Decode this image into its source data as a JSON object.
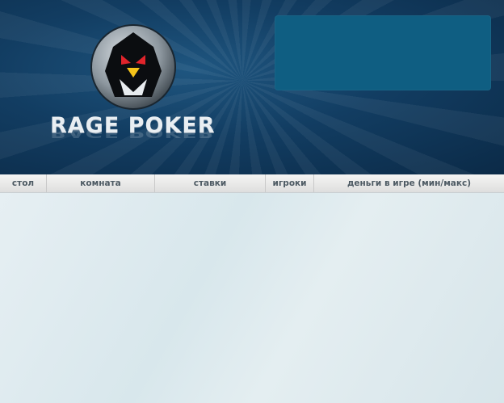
{
  "header": {
    "brand_name": "RAGE POKER",
    "brand_reflection": "RAGE POKER",
    "colors": {
      "background": "#123d62",
      "panel": "#0f5e82",
      "logo_text": "#e9eef2",
      "emblem_eyes": "#e0242b",
      "emblem_beak": "#f4c31a"
    },
    "icons": [
      "penguin-emblem-icon",
      "spade-chip-icon"
    ]
  },
  "table": {
    "columns": [
      {
        "label": "стол"
      },
      {
        "label": "комната"
      },
      {
        "label": "ставки"
      },
      {
        "label": "игроки"
      },
      {
        "label": "деньги в игре (мин/макс)"
      }
    ],
    "rows": []
  }
}
